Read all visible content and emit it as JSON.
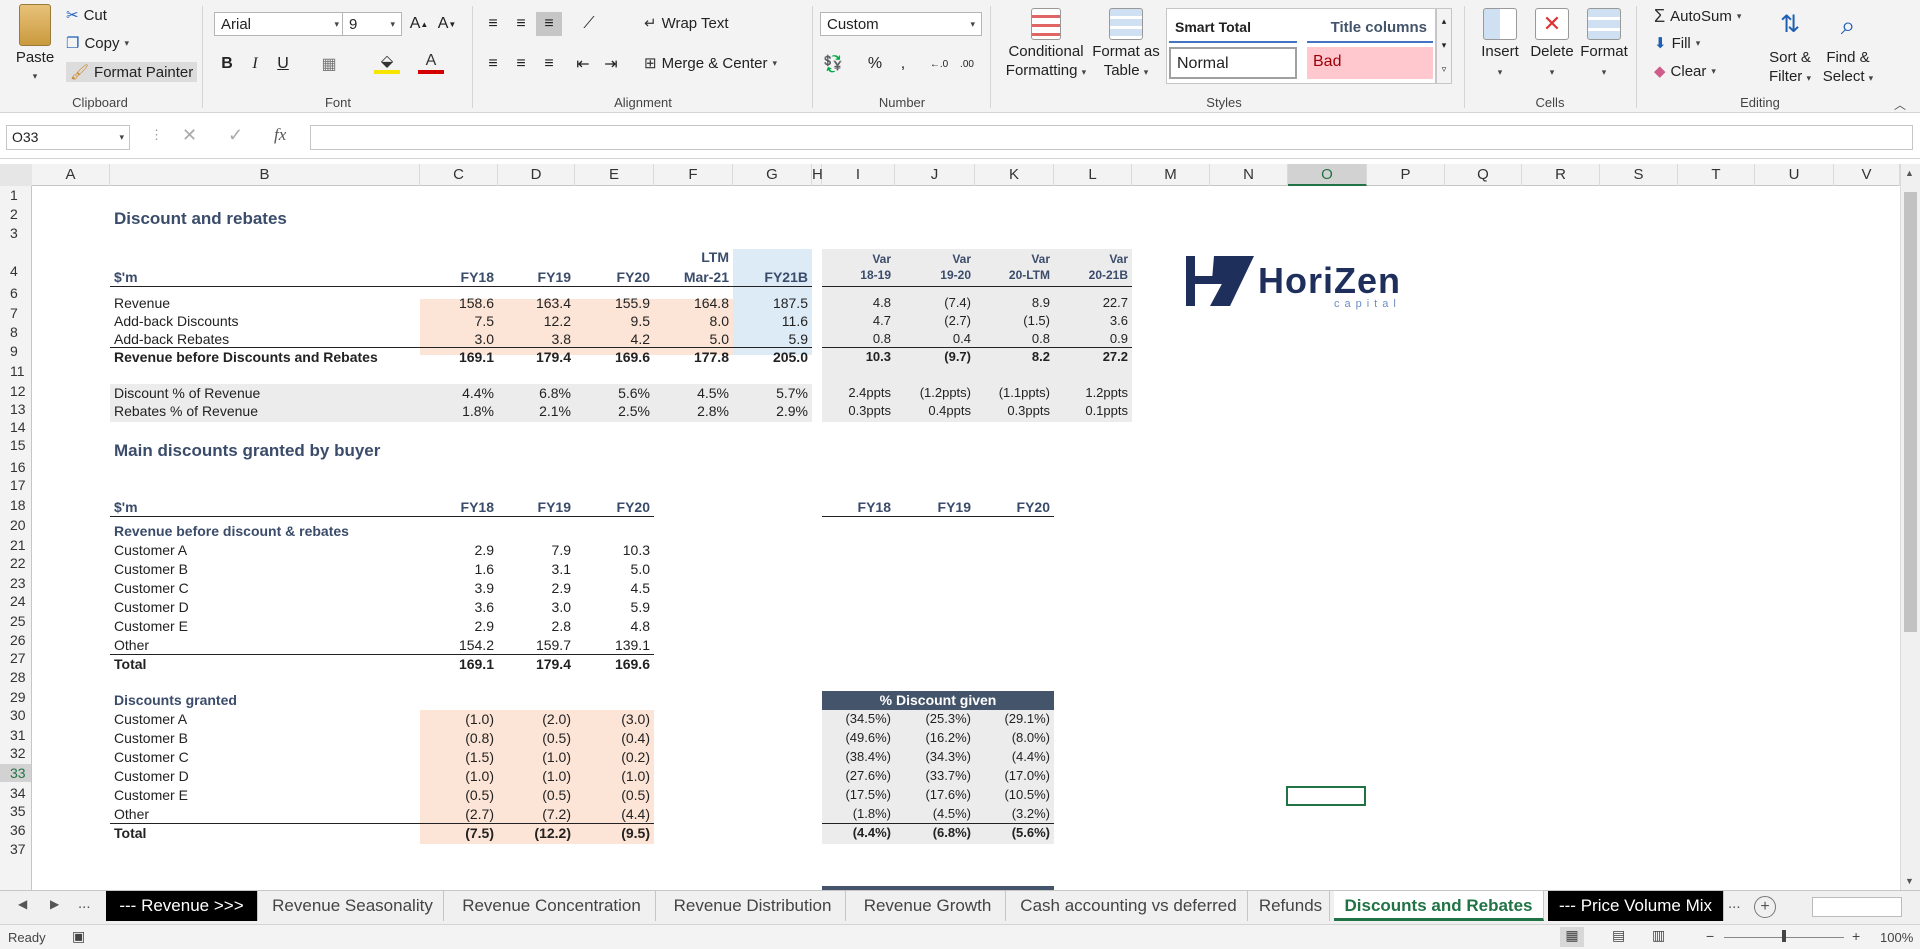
{
  "ribbon": {
    "clipboard": {
      "paste": "Paste",
      "cut": "Cut",
      "copy": "Copy",
      "format_painter": "Format Painter",
      "label": "Clipboard"
    },
    "font": {
      "name": "Arial",
      "size": "9",
      "bold": "B",
      "italic": "I",
      "underline": "U",
      "label": "Font"
    },
    "alignment": {
      "wrap_text": "Wrap Text",
      "merge_center": "Merge & Center",
      "label": "Alignment"
    },
    "number": {
      "format": "Custom",
      "percent": "%",
      "comma": ",",
      "label": "Number"
    },
    "styles": {
      "conditional": "Conditional",
      "conditional2": "Formatting",
      "format_as": "Format as",
      "format_as2": "Table",
      "smart_total": "Smart Total",
      "title_columns": "Title columns",
      "normal": "Normal",
      "bad": "Bad",
      "label": "Styles"
    },
    "cells": {
      "insert": "Insert",
      "delete": "Delete",
      "format": "Format",
      "label": "Cells"
    },
    "editing": {
      "autosum": "AutoSum",
      "fill": "Fill",
      "clear": "Clear",
      "sort": "Sort &",
      "sort2": "Filter",
      "find": "Find &",
      "find2": "Select",
      "label": "Editing"
    }
  },
  "formula_bar": {
    "name_box": "O33",
    "fx": "fx",
    "formula": ""
  },
  "columns": [
    "A",
    "B",
    "C",
    "D",
    "E",
    "F",
    "G",
    "H",
    "I",
    "J",
    "K",
    "L",
    "M",
    "N",
    "O",
    "P",
    "Q",
    "R",
    "S",
    "T",
    "U",
    "V"
  ],
  "rows": [
    "1",
    "2",
    "3",
    "4",
    "6",
    "7",
    "8",
    "9",
    "11",
    "12",
    "13",
    "14",
    "15",
    "16",
    "17",
    "18",
    "20",
    "21",
    "22",
    "23",
    "24",
    "25",
    "26",
    "27",
    "28",
    "29",
    "30",
    "31",
    "32",
    "33",
    "34",
    "35",
    "36",
    "37"
  ],
  "logo": {
    "brand_part1": "Hori",
    "brand_part2": "Zen",
    "tagline": "capital"
  },
  "section1": {
    "title": "Discount and rebates",
    "unit": "$'m",
    "headers": [
      "FY18",
      "FY19",
      "FY20",
      "LTM",
      "Mar-21",
      "FY21B"
    ],
    "var_headers": [
      [
        "Var",
        "18-19"
      ],
      [
        "Var",
        "19-20"
      ],
      [
        "Var",
        "20-LTM"
      ],
      [
        "Var",
        "20-21B"
      ]
    ],
    "rows": [
      {
        "label": "Revenue",
        "values": [
          "158.6",
          "163.4",
          "155.9",
          "164.8",
          "187.5"
        ],
        "vars": [
          "4.8",
          "(7.4)",
          "8.9",
          "22.7"
        ]
      },
      {
        "label": "Add-back Discounts",
        "values": [
          "7.5",
          "12.2",
          "9.5",
          "8.0",
          "11.6"
        ],
        "vars": [
          "4.7",
          "(2.7)",
          "(1.5)",
          "3.6"
        ]
      },
      {
        "label": "Add-back Rebates",
        "values": [
          "3.0",
          "3.8",
          "4.2",
          "5.0",
          "5.9"
        ],
        "vars": [
          "0.8",
          "0.4",
          "0.8",
          "0.9"
        ]
      },
      {
        "label": "Revenue before Discounts and Rebates",
        "values": [
          "169.1",
          "179.4",
          "169.6",
          "177.8",
          "205.0"
        ],
        "vars": [
          "10.3",
          "(9.7)",
          "8.2",
          "27.2"
        ]
      },
      {
        "label": "Discount % of Revenue",
        "values": [
          "4.4%",
          "6.8%",
          "5.6%",
          "4.5%",
          "5.7%"
        ],
        "vars": [
          "2.4ppts",
          "(1.2ppts)",
          "(1.1ppts)",
          "1.2ppts"
        ]
      },
      {
        "label": "Rebates % of Revenue",
        "values": [
          "1.8%",
          "2.1%",
          "2.5%",
          "2.8%",
          "2.9%"
        ],
        "vars": [
          "0.3ppts",
          "0.4ppts",
          "0.3ppts",
          "0.1ppts"
        ]
      }
    ]
  },
  "section2": {
    "title": "Main discounts granted by buyer",
    "unit": "$'m",
    "headers": [
      "FY18",
      "FY19",
      "FY20"
    ],
    "right_headers": [
      "FY18",
      "FY19",
      "FY20"
    ],
    "rev_title": "Revenue before discount & rebates",
    "rev_rows": [
      {
        "label": "Customer A",
        "values": [
          "2.9",
          "7.9",
          "10.3"
        ]
      },
      {
        "label": "Customer B",
        "values": [
          "1.6",
          "3.1",
          "5.0"
        ]
      },
      {
        "label": "Customer C",
        "values": [
          "3.9",
          "2.9",
          "4.5"
        ]
      },
      {
        "label": "Customer D",
        "values": [
          "3.6",
          "3.0",
          "5.9"
        ]
      },
      {
        "label": "Customer E",
        "values": [
          "2.9",
          "2.8",
          "4.8"
        ]
      },
      {
        "label": "Other",
        "values": [
          "154.2",
          "159.7",
          "139.1"
        ]
      },
      {
        "label": "Total",
        "values": [
          "169.1",
          "179.4",
          "169.6"
        ]
      }
    ],
    "disc_title": "Discounts granted",
    "pct_title": "% Discount given",
    "disc_rows": [
      {
        "label": "Customer A",
        "values": [
          "(1.0)",
          "(2.0)",
          "(3.0)"
        ],
        "pct": [
          "(34.5%)",
          "(25.3%)",
          "(29.1%)"
        ]
      },
      {
        "label": "Customer B",
        "values": [
          "(0.8)",
          "(0.5)",
          "(0.4)"
        ],
        "pct": [
          "(49.6%)",
          "(16.2%)",
          "(8.0%)"
        ]
      },
      {
        "label": "Customer C",
        "values": [
          "(1.5)",
          "(1.0)",
          "(0.2)"
        ],
        "pct": [
          "(38.4%)",
          "(34.3%)",
          "(4.4%)"
        ]
      },
      {
        "label": "Customer D",
        "values": [
          "(1.0)",
          "(1.0)",
          "(1.0)"
        ],
        "pct": [
          "(27.6%)",
          "(33.7%)",
          "(17.0%)"
        ]
      },
      {
        "label": "Customer E",
        "values": [
          "(0.5)",
          "(0.5)",
          "(0.5)"
        ],
        "pct": [
          "(17.5%)",
          "(17.6%)",
          "(10.5%)"
        ]
      },
      {
        "label": "Other",
        "values": [
          "(2.7)",
          "(7.2)",
          "(4.4)"
        ],
        "pct": [
          "(1.8%)",
          "(4.5%)",
          "(3.2%)"
        ]
      },
      {
        "label": "Total",
        "values": [
          "(7.5)",
          "(12.2)",
          "(9.5)"
        ],
        "pct": [
          "(4.4%)",
          "(6.8%)",
          "(5.6%)"
        ]
      }
    ]
  },
  "tabs": [
    "--- Revenue >>>",
    "Revenue Seasonality",
    "Revenue Concentration",
    "Revenue Distribution",
    "Revenue Growth",
    "Cash accounting vs deferred",
    "Refunds",
    "Discounts and Rebates",
    "--- Price Volume Mix"
  ],
  "tab_nav": {
    "more": "..."
  },
  "status": {
    "ready": "Ready",
    "zoom": "100%"
  },
  "colors": {
    "accent_green": "#217346",
    "navy": "#44546a",
    "peach": "#fce4d6",
    "light_blue": "#ddebf7",
    "logo_navy": "#1f2f5c"
  }
}
